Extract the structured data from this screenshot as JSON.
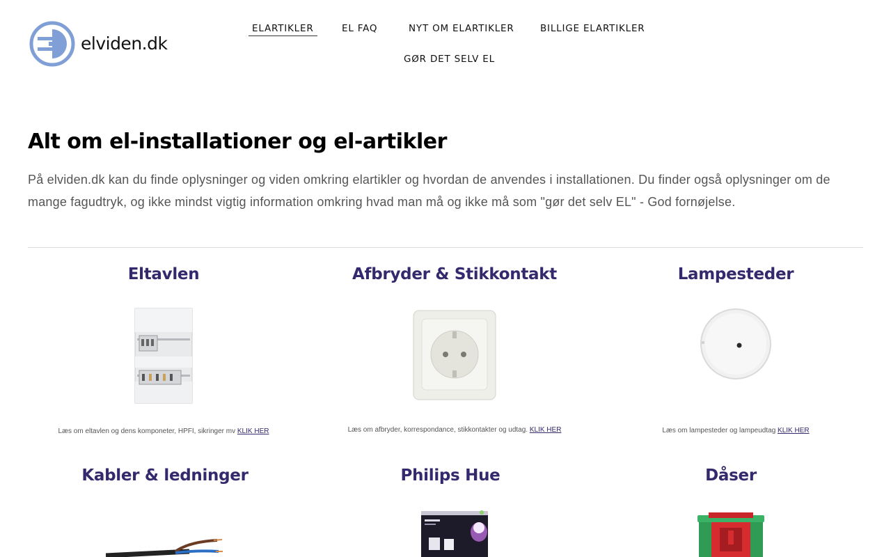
{
  "site": {
    "logo_icon": "elviden-plug-logo",
    "logo_text": "elviden.dk",
    "colors": {
      "link": "#35296e",
      "logo_blue": "#7f9fd6"
    }
  },
  "nav": {
    "items": [
      {
        "label": "ELARTIKLER",
        "active": true
      },
      {
        "label": "EL FAQ"
      },
      {
        "label": "NYT OM ELARTIKLER"
      },
      {
        "label": "BILLIGE ELARTIKLER"
      },
      {
        "label": "GØR DET SELV EL"
      }
    ]
  },
  "hero": {
    "title": "Alt om el-installationer og el-artikler",
    "text": "På elviden.dk kan du finde oplysninger og viden omkring elartikler og hvordan de anvendes i installationen. Du finder også oplysninger om de mange fagudtryk, og ikke mindst vigtig information omkring hvad man må og ikke må som \"gør det selv EL\" - God fornøjelse."
  },
  "cards": [
    {
      "title": "Eltavlen",
      "text": "Læs om eltavlen og dens komponeter, HPFI, sikringer mv ",
      "link": "KLIK HER",
      "image": "fuse-box-image"
    },
    {
      "title": "Afbryder & Stikkontakt",
      "text": "Læs om afbryder, korrespondance, stikkontakter og udtag. ",
      "link": "KLIK HER",
      "image": "wall-socket-image"
    },
    {
      "title": "Lampesteder",
      "text": "Læs om lampesteder og lampeudtag ",
      "link": "KLIK HER",
      "image": "ceiling-outlet-image"
    },
    {
      "title": "Kabler & ledninger",
      "image": "cable-image"
    },
    {
      "title": "Philips Hue",
      "image": "philips-hue-box-image"
    },
    {
      "title": "Dåser",
      "image": "junction-box-image"
    }
  ]
}
